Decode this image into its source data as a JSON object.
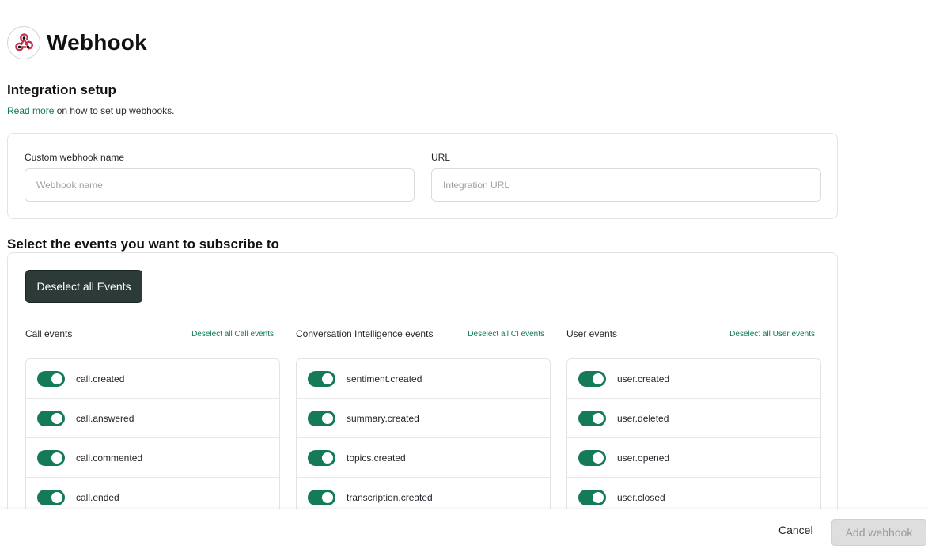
{
  "header": {
    "title": "Webhook",
    "logo_icon": "webhook-icon"
  },
  "setup": {
    "title": "Integration setup",
    "help_link": "Read more",
    "help_text": " on how to set up webhooks.",
    "name_label": "Custom webhook name",
    "name_placeholder": "Webhook name",
    "url_label": "URL",
    "url_placeholder": "Integration URL"
  },
  "events": {
    "title": "Select the events you want to subscribe to",
    "deselect_all": "Deselect all Events",
    "columns": [
      {
        "title": "Call events",
        "deselect": "Deselect all Call events",
        "items": [
          "call.created",
          "call.answered",
          "call.commented",
          "call.ended"
        ]
      },
      {
        "title": "Conversation Intelligence events",
        "deselect": "Deselect all CI events",
        "items": [
          "sentiment.created",
          "summary.created",
          "topics.created",
          "transcription.created"
        ]
      },
      {
        "title": "User events",
        "deselect": "Deselect all User events",
        "items": [
          "user.created",
          "user.deleted",
          "user.opened",
          "user.closed"
        ]
      }
    ]
  },
  "footer": {
    "cancel": "Cancel",
    "add": "Add webhook"
  },
  "colors": {
    "accent": "#157a58",
    "link": "#0f7a5a",
    "dark_button": "#2d3b38"
  }
}
